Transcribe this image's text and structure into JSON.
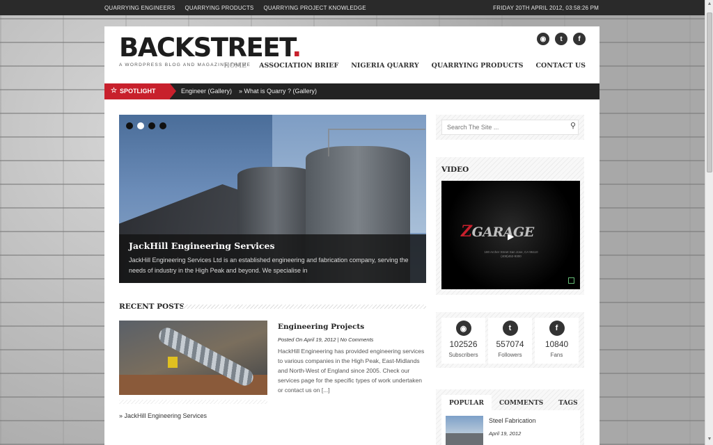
{
  "topbar": {
    "links": [
      "QUARRYING ENGINEERS",
      "QUARRYING PRODUCTS",
      "QUARRYING PROJECT KNOWLEDGE"
    ],
    "datetime": "FRIDAY 20TH APRIL 2012, 03:58:26 PM"
  },
  "header": {
    "logo_text": "BACKSTREET",
    "logo_dot": ".",
    "tagline": "A WORDPRESS BLOG AND MAGAZINE THEME",
    "social_icons": [
      "rss-icon",
      "twitter-icon",
      "facebook-icon"
    ],
    "nav": [
      "HOME",
      "ASSOCIATION BRIEF",
      "NIGERIA QUARRY",
      "QUARRYING PRODUCTS",
      "CONTACT US"
    ],
    "nav_active": "HOME"
  },
  "spotlight": {
    "label": "SPOTLIGHT",
    "items": [
      "Engineer (Gallery)",
      "» What is Quarry ? (Gallery)"
    ]
  },
  "slider": {
    "title": "JackHill Engineering Services",
    "text": "JackHill Engineering Services Ltd is an established engineering and fabrication company, serving the needs of industry in the High Peak and beyond. We specialise in",
    "dots": 4,
    "active_dot": 1
  },
  "recent_posts": {
    "heading": "RECENT POSTS",
    "post": {
      "title": "Engineering Projects",
      "meta_date": "Posted On April 19, 2012",
      "meta_sep": "|",
      "meta_comments": "No Comments",
      "excerpt": "HackHill Engineering has provided engineering services to various companies in the High Peak, East-Midlands and North-West of England since 2005. Check our services page for the specific types of work undertaken or contact us on [...]"
    },
    "link": "» JackHill Engineering Services"
  },
  "sidebar": {
    "search_placeholder": "Search The Site ...",
    "video_heading": "VIDEO",
    "video_brand_z": "Z",
    "video_brand": "GARAGE",
    "video_address": "180 Archer Street San Jose, CA 95110 (408)452-9300",
    "stats": [
      {
        "icon": "rss-icon",
        "value": "102526",
        "label": "Subscribers"
      },
      {
        "icon": "twitter-icon",
        "value": "557074",
        "label": "Followers"
      },
      {
        "icon": "facebook-icon",
        "value": "10840",
        "label": "Fans"
      }
    ],
    "tabs": [
      "POPULAR",
      "COMMENTS",
      "TAGS"
    ],
    "active_tab": "POPULAR",
    "popular_item": {
      "title": "Steel Fabrication",
      "date": "April 19, 2012"
    }
  },
  "colors": {
    "accent": "#c8202c",
    "dark_bar": "#232323",
    "topbar": "#2a2a2a"
  }
}
